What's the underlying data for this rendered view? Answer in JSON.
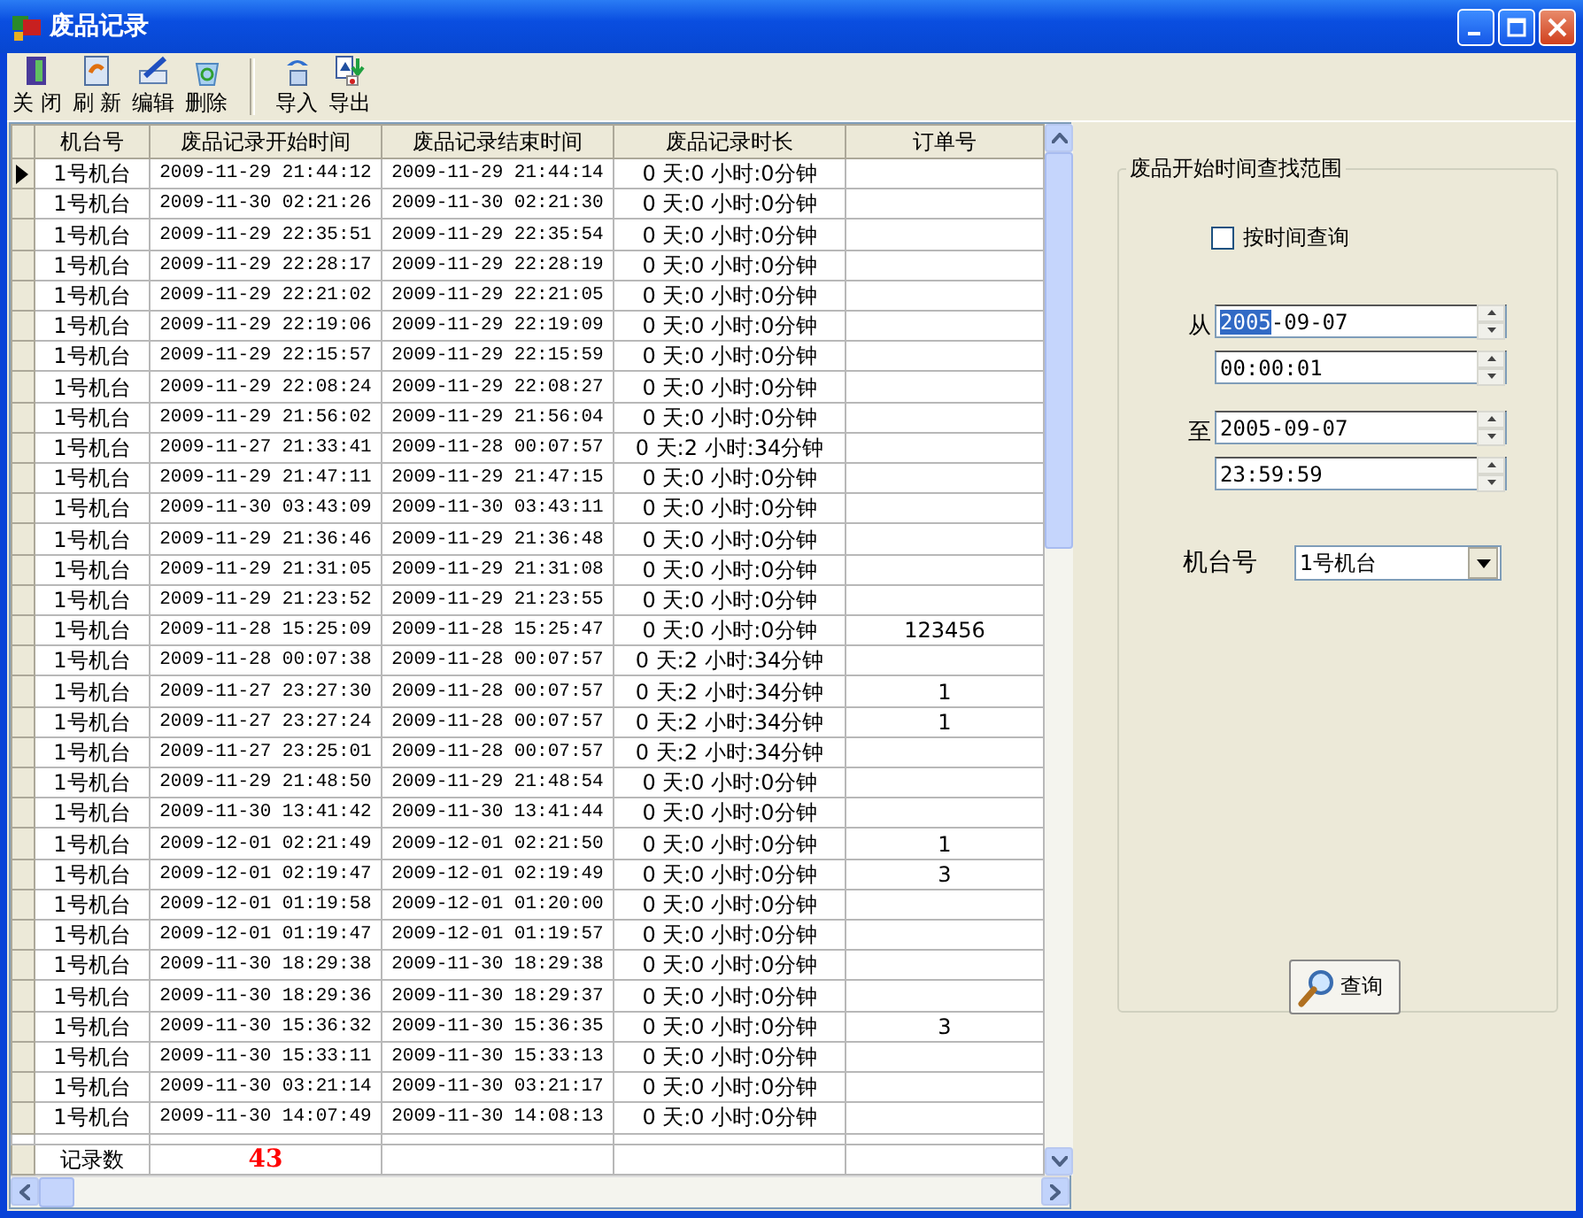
{
  "window": {
    "title": "废品记录"
  },
  "toolbar": [
    {
      "label": "关 闭",
      "kind": "close"
    },
    {
      "label": "刷 新",
      "kind": "refresh"
    },
    {
      "label": "编辑",
      "kind": "edit"
    },
    {
      "label": "删除",
      "kind": "delete"
    },
    {
      "label": "导入",
      "kind": "import"
    },
    {
      "label": "导出",
      "kind": "export"
    }
  ],
  "table": {
    "columns": [
      "机台号",
      "废品记录开始时间",
      "废品记录结束时间",
      "废品记录时长",
      "订单号"
    ],
    "rows": [
      {
        "current": true,
        "cells": [
          "1号机台",
          "2009-11-29 21:44:12",
          "2009-11-29 21:44:14",
          "0 天:0 小时:0分钟",
          ""
        ]
      },
      {
        "current": false,
        "cells": [
          "1号机台",
          "2009-11-30 02:21:26",
          "2009-11-30 02:21:30",
          "0 天:0 小时:0分钟",
          ""
        ]
      },
      {
        "current": false,
        "cells": [
          "1号机台",
          "2009-11-29 22:35:51",
          "2009-11-29 22:35:54",
          "0 天:0 小时:0分钟",
          ""
        ]
      },
      {
        "current": false,
        "cells": [
          "1号机台",
          "2009-11-29 22:28:17",
          "2009-11-29 22:28:19",
          "0 天:0 小时:0分钟",
          ""
        ]
      },
      {
        "current": false,
        "cells": [
          "1号机台",
          "2009-11-29 22:21:02",
          "2009-11-29 22:21:05",
          "0 天:0 小时:0分钟",
          ""
        ]
      },
      {
        "current": false,
        "cells": [
          "1号机台",
          "2009-11-29 22:19:06",
          "2009-11-29 22:19:09",
          "0 天:0 小时:0分钟",
          ""
        ]
      },
      {
        "current": false,
        "cells": [
          "1号机台",
          "2009-11-29 22:15:57",
          "2009-11-29 22:15:59",
          "0 天:0 小时:0分钟",
          ""
        ]
      },
      {
        "current": false,
        "cells": [
          "1号机台",
          "2009-11-29 22:08:24",
          "2009-11-29 22:08:27",
          "0 天:0 小时:0分钟",
          ""
        ]
      },
      {
        "current": false,
        "cells": [
          "1号机台",
          "2009-11-29 21:56:02",
          "2009-11-29 21:56:04",
          "0 天:0 小时:0分钟",
          ""
        ]
      },
      {
        "current": false,
        "cells": [
          "1号机台",
          "2009-11-27 21:33:41",
          "2009-11-28 00:07:57",
          "0 天:2 小时:34分钟",
          ""
        ]
      },
      {
        "current": false,
        "cells": [
          "1号机台",
          "2009-11-29 21:47:11",
          "2009-11-29 21:47:15",
          "0 天:0 小时:0分钟",
          ""
        ]
      },
      {
        "current": false,
        "cells": [
          "1号机台",
          "2009-11-30 03:43:09",
          "2009-11-30 03:43:11",
          "0 天:0 小时:0分钟",
          ""
        ]
      },
      {
        "current": false,
        "cells": [
          "1号机台",
          "2009-11-29 21:36:46",
          "2009-11-29 21:36:48",
          "0 天:0 小时:0分钟",
          ""
        ]
      },
      {
        "current": false,
        "cells": [
          "1号机台",
          "2009-11-29 21:31:05",
          "2009-11-29 21:31:08",
          "0 天:0 小时:0分钟",
          ""
        ]
      },
      {
        "current": false,
        "cells": [
          "1号机台",
          "2009-11-29 21:23:52",
          "2009-11-29 21:23:55",
          "0 天:0 小时:0分钟",
          ""
        ]
      },
      {
        "current": false,
        "cells": [
          "1号机台",
          "2009-11-28 15:25:09",
          "2009-11-28 15:25:47",
          "0 天:0 小时:0分钟",
          "123456"
        ]
      },
      {
        "current": false,
        "cells": [
          "1号机台",
          "2009-11-28 00:07:38",
          "2009-11-28 00:07:57",
          "0 天:2 小时:34分钟",
          ""
        ]
      },
      {
        "current": false,
        "cells": [
          "1号机台",
          "2009-11-27 23:27:30",
          "2009-11-28 00:07:57",
          "0 天:2 小时:34分钟",
          "1"
        ]
      },
      {
        "current": false,
        "cells": [
          "1号机台",
          "2009-11-27 23:27:24",
          "2009-11-28 00:07:57",
          "0 天:2 小时:34分钟",
          "1"
        ]
      },
      {
        "current": false,
        "cells": [
          "1号机台",
          "2009-11-27 23:25:01",
          "2009-11-28 00:07:57",
          "0 天:2 小时:34分钟",
          ""
        ]
      },
      {
        "current": false,
        "cells": [
          "1号机台",
          "2009-11-29 21:48:50",
          "2009-11-29 21:48:54",
          "0 天:0 小时:0分钟",
          ""
        ]
      },
      {
        "current": false,
        "cells": [
          "1号机台",
          "2009-11-30 13:41:42",
          "2009-11-30 13:41:44",
          "0 天:0 小时:0分钟",
          ""
        ]
      },
      {
        "current": false,
        "cells": [
          "1号机台",
          "2009-12-01 02:21:49",
          "2009-12-01 02:21:50",
          "0 天:0 小时:0分钟",
          "1"
        ]
      },
      {
        "current": false,
        "cells": [
          "1号机台",
          "2009-12-01 02:19:47",
          "2009-12-01 02:19:49",
          "0 天:0 小时:0分钟",
          "3"
        ]
      },
      {
        "current": false,
        "cells": [
          "1号机台",
          "2009-12-01 01:19:58",
          "2009-12-01 01:20:00",
          "0 天:0 小时:0分钟",
          ""
        ]
      },
      {
        "current": false,
        "cells": [
          "1号机台",
          "2009-12-01 01:19:47",
          "2009-12-01 01:19:57",
          "0 天:0 小时:0分钟",
          ""
        ]
      },
      {
        "current": false,
        "cells": [
          "1号机台",
          "2009-11-30 18:29:38",
          "2009-11-30 18:29:38",
          "0 天:0 小时:0分钟",
          ""
        ]
      },
      {
        "current": false,
        "cells": [
          "1号机台",
          "2009-11-30 18:29:36",
          "2009-11-30 18:29:37",
          "0 天:0 小时:0分钟",
          ""
        ]
      },
      {
        "current": false,
        "cells": [
          "1号机台",
          "2009-11-30 15:36:32",
          "2009-11-30 15:36:35",
          "0 天:0 小时:0分钟",
          "3"
        ]
      },
      {
        "current": false,
        "cells": [
          "1号机台",
          "2009-11-30 15:33:11",
          "2009-11-30 15:33:13",
          "0 天:0 小时:0分钟",
          ""
        ]
      },
      {
        "current": false,
        "cells": [
          "1号机台",
          "2009-11-30 03:21:14",
          "2009-11-30 03:21:17",
          "0 天:0 小时:0分钟",
          ""
        ]
      },
      {
        "current": false,
        "cells": [
          "1号机台",
          "2009-11-30 14:07:49",
          "2009-11-30 14:08:13",
          "0 天:0 小时:0分钟",
          ""
        ]
      }
    ],
    "footer": {
      "label": "记录数",
      "count": "43"
    }
  },
  "search": {
    "title": "废品开始时间查找范围",
    "by_time": {
      "label": "按时间查询",
      "checked": false
    },
    "from_label": "从",
    "from_date": {
      "selected_part": "2005",
      "rest": "-09-07"
    },
    "from_time": "00:00:01",
    "to_label": "至",
    "to_date": "2005-09-07",
    "to_time": "23:59:59",
    "machine_label": "机台号",
    "machine_value": "1号机台",
    "query_button": "查询"
  }
}
